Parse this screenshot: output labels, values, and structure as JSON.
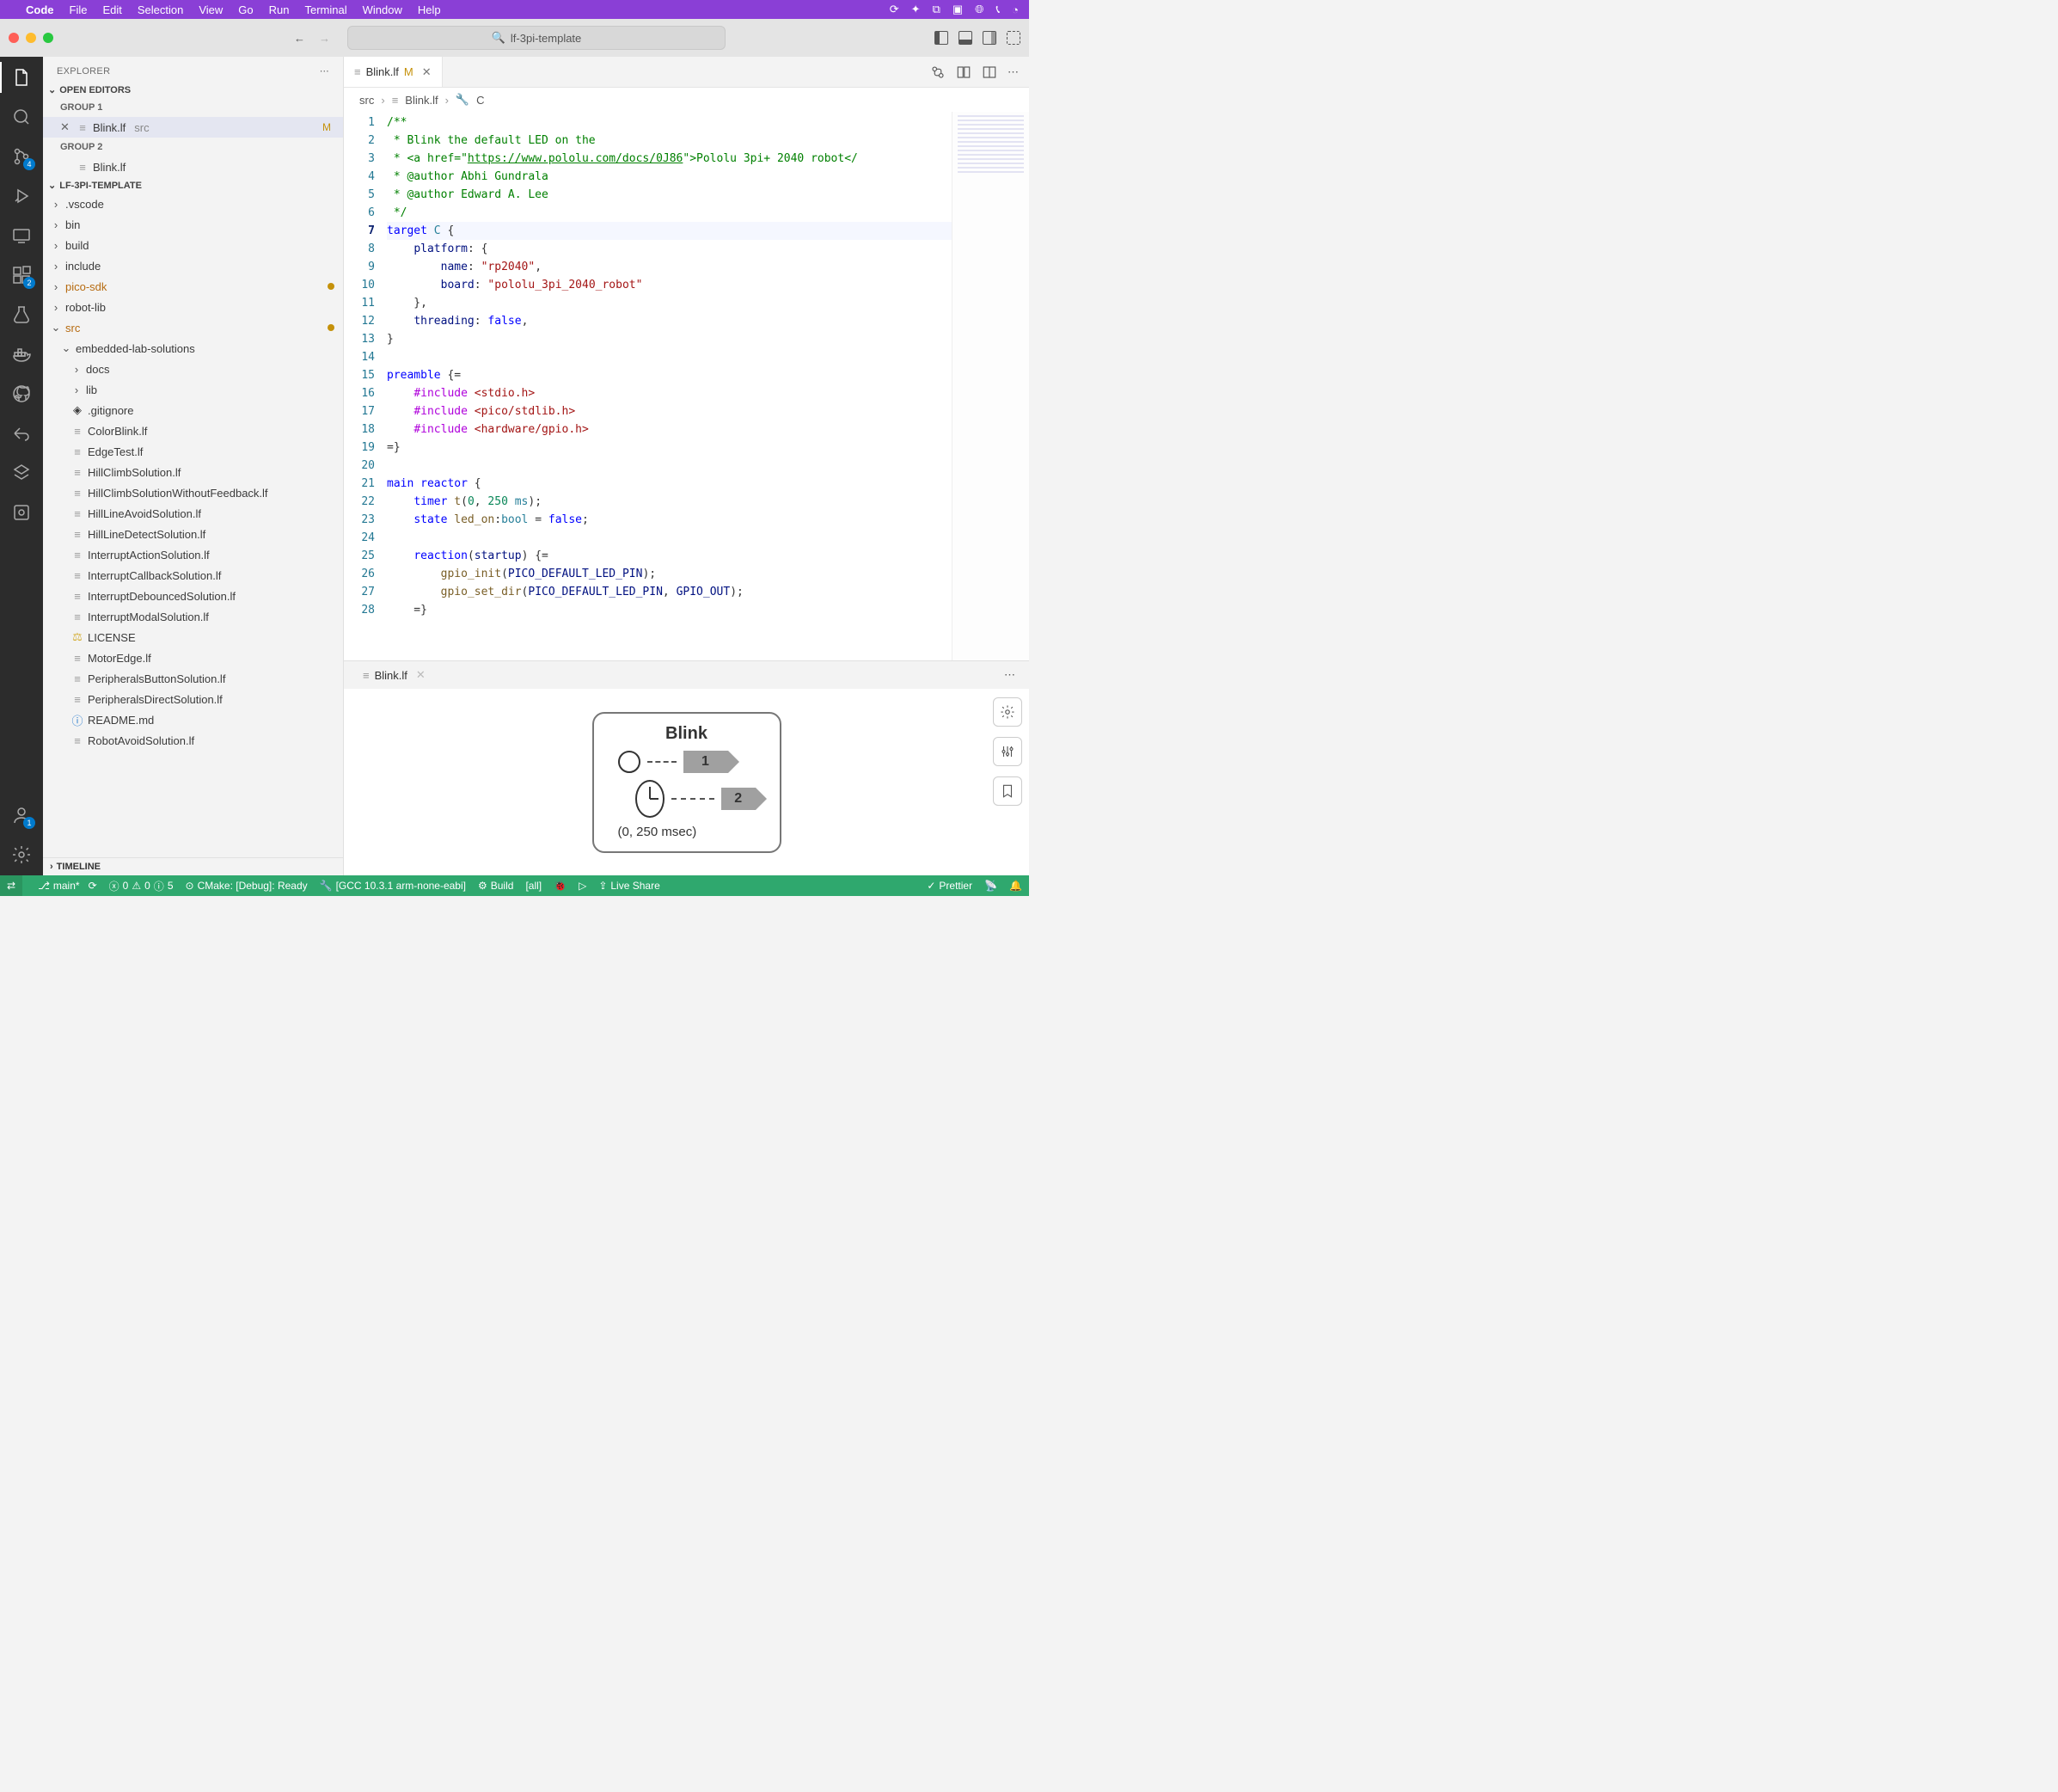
{
  "macMenu": {
    "app": "Code",
    "items": [
      "File",
      "Edit",
      "Selection",
      "View",
      "Go",
      "Run",
      "Terminal",
      "Window",
      "Help"
    ]
  },
  "commandCenter": {
    "text": "lf-3pi-template"
  },
  "explorer": {
    "title": "EXPLORER",
    "openEditors": "OPEN EDITORS",
    "group1": "GROUP 1",
    "group2": "GROUP 2",
    "openFile": "Blink.lf",
    "openFileDir": "src",
    "openFileBadge": "M",
    "panelFile": "Blink.lf",
    "projectHeader": "LF-3PI-TEMPLATE",
    "folders": {
      "vscode": ".vscode",
      "bin": "bin",
      "build": "build",
      "include": "include",
      "picoSdk": "pico-sdk",
      "robotLib": "robot-lib",
      "src": "src",
      "embedded": "embedded-lab-solutions",
      "docs": "docs",
      "lib": "lib"
    },
    "files": {
      "gitignore": ".gitignore",
      "colorBlink": "ColorBlink.lf",
      "edgeTest": "EdgeTest.lf",
      "hillClimb": "HillClimbSolution.lf",
      "hillClimbNoFb": "HillClimbSolutionWithoutFeedback.lf",
      "hillLineAvoid": "HillLineAvoidSolution.lf",
      "hillLineDetect": "HillLineDetectSolution.lf",
      "interruptAction": "InterruptActionSolution.lf",
      "interruptCallback": "InterruptCallbackSolution.lf",
      "interruptDebounced": "InterruptDebouncedSolution.lf",
      "interruptModal": "InterruptModalSolution.lf",
      "license": "LICENSE",
      "motorEdge": "MotorEdge.lf",
      "periphButton": "PeripheralsButtonSolution.lf",
      "periphDirect": "PeripheralsDirectSolution.lf",
      "readme": "README.md",
      "robotAvoid": "RobotAvoidSolution.lf"
    },
    "timeline": "TIMELINE"
  },
  "editor": {
    "tabFile": "Blink.lf",
    "tabBadge": "M",
    "breadcrumb": {
      "seg1": "src",
      "seg2": "Blink.lf",
      "seg3": "C"
    },
    "lines": [
      "/**",
      " * Blink the default LED on the",
      " * <a href=\"https://www.pololu.com/docs/0J86\">Pololu 3pi+ 2040 robot</",
      " * @author Abhi Gundrala",
      " * @author Edward A. Lee",
      " */",
      "target C {",
      "    platform: {",
      "        name: \"rp2040\",",
      "        board: \"pololu_3pi_2040_robot\"",
      "    },",
      "    threading: false,",
      "}",
      "",
      "preamble {=",
      "    #include <stdio.h>",
      "    #include <pico/stdlib.h>",
      "    #include <hardware/gpio.h>",
      "=}",
      "",
      "main reactor {",
      "    timer t(0, 250 ms);",
      "    state led_on:bool = false;",
      "",
      "    reaction(startup) {=",
      "        gpio_init(PICO_DEFAULT_LED_PIN);",
      "        gpio_set_dir(PICO_DEFAULT_LED_PIN, GPIO_OUT);",
      "    =}"
    ],
    "currentLine": 7
  },
  "panel": {
    "tabFile": "Blink.lf",
    "diagramTitle": "Blink",
    "r1": "1",
    "r2": "2",
    "caption": "(0, 250 msec)"
  },
  "statusbar": {
    "branch": "main*",
    "errors": "0",
    "warnings": "0",
    "info": "5",
    "cmake": "CMake: [Debug]: Ready",
    "kit": "[GCC 10.3.1 arm-none-eabi]",
    "build": "Build",
    "target": "[all]",
    "liveshare": "Live Share",
    "prettier": "Prettier"
  },
  "badges": {
    "scm": "4",
    "ext": "2",
    "acct": "1"
  }
}
